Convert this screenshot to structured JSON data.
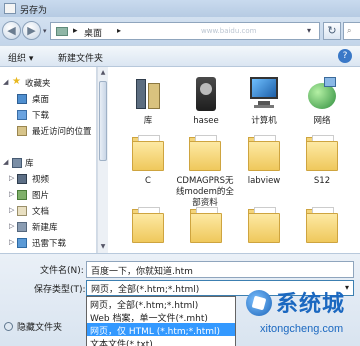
{
  "window": {
    "title": "另存为"
  },
  "address": {
    "separator": "▸",
    "location": "桌面",
    "arrow": "▸",
    "ghost_text": "www.baidu.com"
  },
  "toolbar": {
    "organize": "组织 ▾",
    "new_folder": "新建文件夹",
    "help": "?"
  },
  "nav": {
    "items": [
      {
        "label": "收藏夹",
        "icon": "star-icon",
        "group": true
      },
      {
        "label": "桌面",
        "icon": "desktop-icon"
      },
      {
        "label": "下载",
        "icon": "download-icon"
      },
      {
        "label": "最近访问的位置",
        "icon": "recent-icon"
      },
      {
        "label": "库",
        "icon": "library-icon",
        "group": true
      },
      {
        "label": "视频",
        "icon": "video-icon"
      },
      {
        "label": "图片",
        "icon": "picture-icon"
      },
      {
        "label": "文档",
        "icon": "document-icon"
      },
      {
        "label": "新建库",
        "icon": "library-icon"
      },
      {
        "label": "迅雷下载",
        "icon": "thunder-icon"
      }
    ]
  },
  "files": [
    {
      "label": "库",
      "icon": "library-icon"
    },
    {
      "label": "hasee",
      "icon": "user-icon"
    },
    {
      "label": "计算机",
      "icon": "computer-icon"
    },
    {
      "label": "网络",
      "icon": "network-icon"
    },
    {
      "label": "C",
      "icon": "folder-icon"
    },
    {
      "label": "CDMAGPRS无线modem的全部资料",
      "icon": "folder-icon"
    },
    {
      "label": "labview",
      "icon": "folder-icon"
    },
    {
      "label": "S12",
      "icon": "folder-icon"
    },
    {
      "label": "",
      "icon": "folder-icon"
    },
    {
      "label": "",
      "icon": "folder-icon"
    },
    {
      "label": "",
      "icon": "folder-icon"
    },
    {
      "label": "",
      "icon": "folder-icon"
    }
  ],
  "form": {
    "filename_label": "文件名(N):",
    "filename_value": "百度一下，你就知道.htm",
    "filetype_label": "保存类型(T):",
    "filetype_value": "网页，全部(*.htm;*.html)",
    "filetype_options": [
      "网页，全部(*.htm;*.html)",
      "Web 档案，单一文件(*.mht)",
      "网页，仅 HTML (*.htm;*.html)",
      "文本文件(*.txt)"
    ],
    "selected_option_index": 2,
    "hide_folders": "隐藏文件夹"
  },
  "watermark": {
    "brand": "系统城",
    "url": "xitongcheng.com"
  },
  "colors": {
    "selection": "#3399ff",
    "folder": "#efc85c",
    "chrome": "#c9daee"
  }
}
